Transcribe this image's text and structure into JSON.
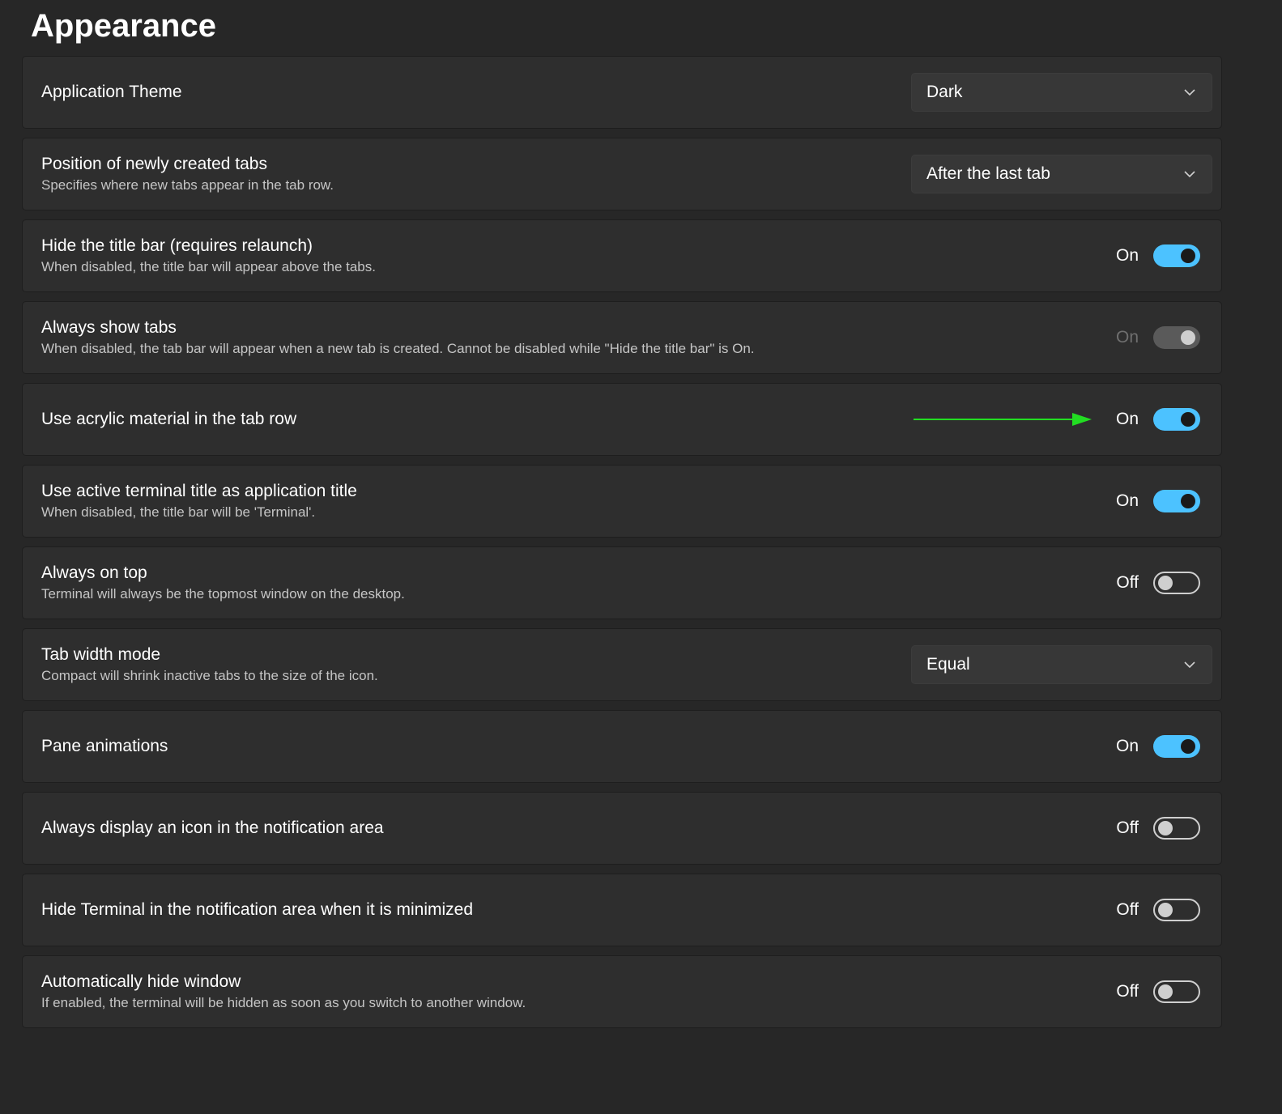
{
  "page": {
    "title": "Appearance"
  },
  "colors": {
    "accent": "#4cc2ff",
    "card": "#2e2e2e",
    "background": "#272727",
    "annotation_arrow": "#22dd22"
  },
  "settings": [
    {
      "label": "Application Theme",
      "description": "",
      "control": "dropdown",
      "value": "Dark"
    },
    {
      "label": "Position of newly created tabs",
      "description": "Specifies where new tabs appear in the tab row.",
      "control": "dropdown",
      "value": "After the last tab"
    },
    {
      "label": "Hide the title bar (requires relaunch)",
      "description": "When disabled, the title bar will appear above the tabs.",
      "control": "toggle",
      "state": "On"
    },
    {
      "label": "Always show tabs",
      "description": "When disabled, the tab bar will appear when a new tab is created. Cannot be disabled while \"Hide the title bar\" is On.",
      "control": "toggle",
      "state": "On",
      "disabled": true
    },
    {
      "label": "Use acrylic material in the tab row",
      "description": "",
      "control": "toggle",
      "state": "On",
      "annotation": "arrow-icon"
    },
    {
      "label": "Use active terminal title as application title",
      "description": "When disabled, the title bar will be 'Terminal'.",
      "control": "toggle",
      "state": "On"
    },
    {
      "label": "Always on top",
      "description": "Terminal will always be the topmost window on the desktop.",
      "control": "toggle",
      "state": "Off"
    },
    {
      "label": "Tab width mode",
      "description": "Compact will shrink inactive tabs to the size of the icon.",
      "control": "dropdown",
      "value": "Equal"
    },
    {
      "label": "Pane animations",
      "description": "",
      "control": "toggle",
      "state": "On"
    },
    {
      "label": "Always display an icon in the notification area",
      "description": "",
      "control": "toggle",
      "state": "Off"
    },
    {
      "label": "Hide Terminal in the notification area when it is minimized",
      "description": "",
      "control": "toggle",
      "state": "Off"
    },
    {
      "label": "Automatically hide window",
      "description": "If enabled, the terminal will be hidden as soon as you switch to another window.",
      "control": "toggle",
      "state": "Off"
    }
  ]
}
